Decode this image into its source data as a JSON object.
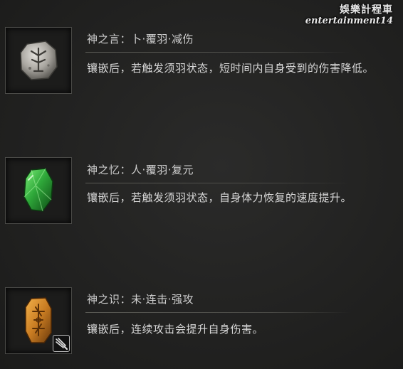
{
  "watermark": {
    "line1": "娛樂計程車",
    "line2": "entertainment14"
  },
  "entries": [
    {
      "title": "神之言：卜·覆羽·减伤",
      "description": "镶嵌后，若触发须羽状态，短时间内自身受到的伤害降低。",
      "gem_icon": "silver-rune-stone-icon",
      "gem_color": "#b9b6b0"
    },
    {
      "title": "神之忆：人·覆羽·复元",
      "description": "镶嵌后，若触发须羽状态，自身体力恢复的速度提升。",
      "gem_icon": "green-crystal-icon",
      "gem_color": "#2fa83a"
    },
    {
      "title": "神之识：未·连击·强攻",
      "description": "镶嵌后，连续攻击会提升自身伤害。",
      "gem_icon": "amber-rune-stone-icon",
      "gem_color": "#d0892a",
      "badge_icon": "crossed-spears-icon"
    }
  ]
}
